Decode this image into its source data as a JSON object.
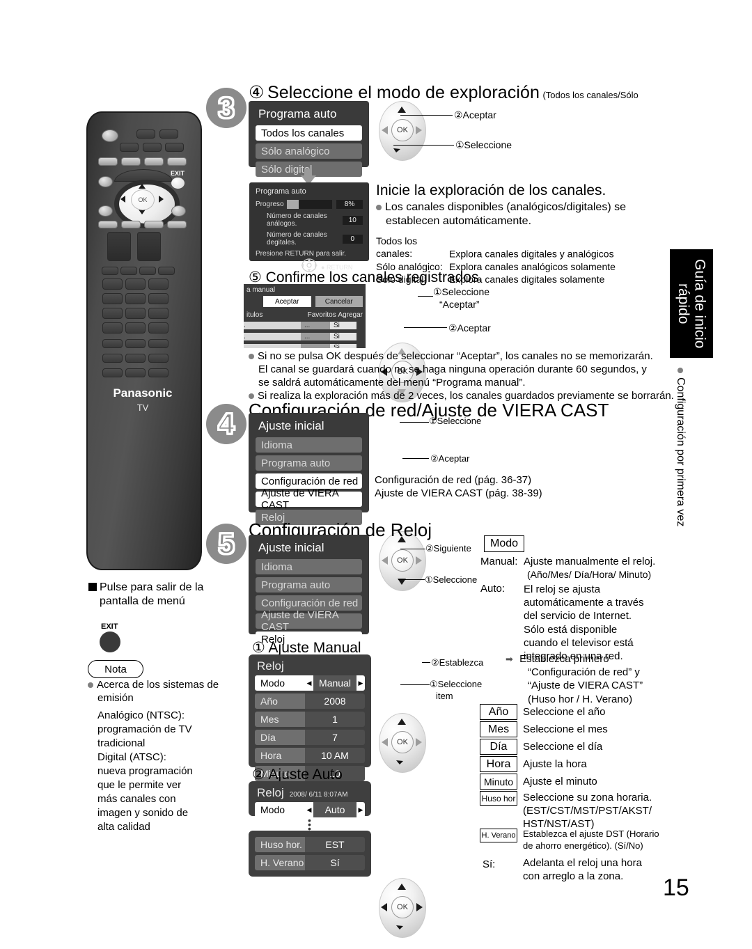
{
  "page": {
    "number": "15"
  },
  "side_tab": {
    "title": "Guía de inicio rápido",
    "subtitle": "Configuración por primera vez"
  },
  "remote": {
    "brand": "Panasonic",
    "sub_brand": "TV",
    "exit_label": "EXIT",
    "ok_label": "OK"
  },
  "left_column": {
    "exit_note": "Pulse para salir de la pantalla de menú",
    "exit_key_label": "EXIT",
    "nota_label": "Nota",
    "note_heading": "Acerca de los sistemas de emisión",
    "note_body": "Analógico (NTSC): programación de TV tradicional\nDigital (ATSC): nueva programación que le permite ver más canales con imagen y sonido de alta calidad",
    "note_lines": [
      "Analógico (NTSC):",
      "programación de TV",
      "tradicional",
      "Digital (ATSC):",
      "nueva programación",
      "que le permite ver",
      "más canales con",
      "imagen y sonido de",
      "alta calidad"
    ]
  },
  "step3": {
    "badge": "3",
    "heading_num": "④",
    "heading": "Seleccione el modo de exploración",
    "heading_paren": "(Todos los canales/Sólo analógico/Sólo digital)",
    "osd": {
      "title": "Programa auto",
      "items": [
        {
          "label": "Todos los canales",
          "state": "selected"
        },
        {
          "label": "Sólo analógico",
          "state": "dim"
        },
        {
          "label": "Sólo digital",
          "state": "dim"
        }
      ]
    },
    "dpad_callouts": {
      "top": "②Aceptar",
      "bottom": "①Seleccione"
    },
    "progress_osd": {
      "title": "Programa auto",
      "progress_label": "Progreso",
      "progress_value": "8%",
      "rows": [
        {
          "label": "Número de canales análogos.",
          "value": "10"
        },
        {
          "label": "Número de canales degitales.",
          "value": "0"
        }
      ],
      "footer": "Presione RETURN para salir.",
      "return_label": "RETURN"
    },
    "scan_heading": "Inicie la exploración de los canales.",
    "scan_bullet": "Los canales disponibles (analógicos/digitales) se establecen automáticamente.",
    "scan_modes": [
      {
        "name": "Todos los canales:",
        "desc": "Explora canales digitales y analógicos"
      },
      {
        "name": "Sólo analógico:",
        "desc": "Explora canales analógicos solamente"
      },
      {
        "name": "Sólo digital:",
        "desc": "Explora canales digitales solamente"
      }
    ],
    "confirm_num": "⑤",
    "confirm_heading": "Confirme los canales registrados.",
    "table": {
      "title": "a manual",
      "accept": "Aceptar",
      "cancel": "Cancelar",
      "col_titles": "itulos",
      "col_favorites": "Favoritos",
      "col_add": "Agregar",
      "rows": [
        {
          "name": ".",
          "fav": "...",
          "add": "Si"
        },
        {
          "name": ".",
          "fav": "...",
          "add": "Si"
        },
        {
          "name": ".",
          "fav": "...",
          "add": "Si"
        }
      ]
    },
    "table_callouts": {
      "top": "①Seleccione\n“Aceptar”",
      "top1": "①Seleccione",
      "top2": "“Aceptar”",
      "bottom": "②Aceptar"
    },
    "notes": [
      "Si no se pulsa OK después de seleccionar “Aceptar”, los canales no se memorizarán. El canal se guardará cuando no se haga ninguna operación durante 60 segundos, y se saldrá automáticamente del menú “Programa manual”.",
      "Si realiza la exploración más de 2 veces, los canales guardados previamente se borrarán."
    ],
    "note1_lines": [
      "Si no se pulsa OK después de seleccionar “Aceptar”, los canales no se memorizarán.",
      "El canal se guardará cuando no se haga ninguna operación durante 60 segundos, y",
      "se saldrá automáticamente del menú “Programa manual”."
    ]
  },
  "step4": {
    "badge": "4",
    "heading": "Configuración de red/Ajuste de VIERA CAST",
    "osd": {
      "title": "Ajuste inicial",
      "items": [
        {
          "label": "Idioma",
          "state": "dim"
        },
        {
          "label": "Programa auto",
          "state": "dim"
        },
        {
          "label": "Configuración de red",
          "state": "selected"
        },
        {
          "label": "Ajuste de VIERA CAST",
          "state": "selected"
        },
        {
          "label": "Reloj",
          "state": "dim"
        }
      ]
    },
    "dpad_callouts": {
      "top": "①Seleccione",
      "bottom": "②Aceptar"
    },
    "refs": [
      "Configuración de red (pág. 36-37)",
      "Ajuste de VIERA CAST (pág. 38-39)"
    ]
  },
  "step5": {
    "badge": "5",
    "heading": "Configuración de Reloj",
    "osd": {
      "title": "Ajuste inicial",
      "items": [
        {
          "label": "Idioma",
          "state": "dim"
        },
        {
          "label": "Programa auto",
          "state": "dim"
        },
        {
          "label": "Configuración de red",
          "state": "dim"
        },
        {
          "label": "Ajuste de VIERA CAST",
          "state": "dim"
        },
        {
          "label": "Reloj",
          "state": "selected"
        }
      ]
    },
    "dpad_callouts": {
      "top": "②Siguiente",
      "bottom": "①Seleccione"
    },
    "mode_key": "Modo",
    "mode_manual_label": "Manual:",
    "mode_manual_desc": "Ajuste manualmente el reloj.",
    "mode_manual_desc2": "(Año/Mes/ Día/Hora/ Minuto)",
    "mode_auto_label": "Auto:",
    "mode_auto_lines": [
      "El reloj se ajusta",
      "automáticamente a través",
      "del servicio de Internet.",
      "Sólo está disponible",
      "cuando el televisor está",
      "integrado en una red."
    ],
    "arrow_note_lines": [
      "Establezca primero",
      "“Configuración de red” y",
      "“Ajuste de VIERA CAST”",
      "(Huso hor / H. Verano)"
    ],
    "manual_num": "①",
    "manual_title": "Ajuste Manual",
    "manual_osd": {
      "title": "Reloj",
      "rows": [
        {
          "label": "Modo",
          "value": "Manual",
          "state": "selected",
          "arrows": true
        },
        {
          "label": "Año",
          "value": "2008",
          "state": "dim",
          "arrows": false
        },
        {
          "label": "Mes",
          "value": "1",
          "state": "dim",
          "arrows": false
        },
        {
          "label": "Día",
          "value": "7",
          "state": "dim",
          "arrows": false
        },
        {
          "label": "Hora",
          "value": "10 AM",
          "state": "dim",
          "arrows": false
        },
        {
          "label": "Minuto",
          "value": "10",
          "state": "dim",
          "arrows": false
        }
      ]
    },
    "manual_callouts": {
      "top": "②Establezca",
      "bottom1": "①Seleccione",
      "bottom2": "item"
    },
    "auto_num": "②",
    "auto_title": "Ajuste Auto",
    "auto_osd": {
      "title": "Reloj",
      "timestamp": "2008/ 6/11 8:07AM",
      "mode_row": {
        "label": "Modo",
        "value": "Auto"
      },
      "rows": [
        {
          "label": "Huso hor.",
          "value": "EST"
        },
        {
          "label": "H. Verano",
          "value": "Sí"
        }
      ]
    },
    "key_table": [
      {
        "key": "Año",
        "desc": "Seleccione el año"
      },
      {
        "key": "Mes",
        "desc": "Seleccione el mes"
      },
      {
        "key": "Día",
        "desc": "Seleccione el día"
      },
      {
        "key": "Hora",
        "desc": "Ajuste la hora"
      },
      {
        "key": "Minuto",
        "desc": "Ajuste el minuto"
      },
      {
        "key": "Huso hor",
        "desc": "Seleccione su zona horaria.\n(EST/CST/MST/PST/AKST/\nHST/NST/AST)"
      },
      {
        "key": "H. Verano",
        "desc": "Establezca el ajuste DST (Horario\nde ahorro energético). (Sí/No)"
      }
    ],
    "huso_desc_lines": [
      "Seleccione su zona horaria.",
      "(EST/CST/MST/PST/AKST/",
      "HST/NST/AST)"
    ],
    "verano_desc_lines": [
      "Establezca el ajuste DST (Horario",
      "de ahorro energético). (Sí/No)"
    ],
    "si_label": "Sí:",
    "si_desc_lines": [
      "Adelanta el reloj una hora",
      "con arreglo a la zona."
    ]
  }
}
